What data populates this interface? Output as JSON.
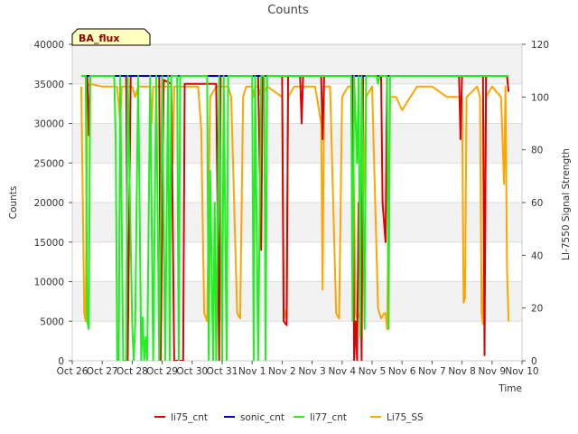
{
  "chart_data": {
    "type": "line",
    "title": "Counts",
    "badge": "BA_flux",
    "xlabel": "Time",
    "ylabel": "Counts",
    "y2label": "LI-7550 Signal Strength",
    "x_ticks": [
      "Oct 26",
      "Oct 27",
      "Oct 28",
      "Oct 29",
      "Oct 30",
      "Oct 31",
      "Nov 1",
      "Nov 2",
      "Nov 3",
      "Nov 4",
      "Nov 5",
      "Nov 6",
      "Nov 7",
      "Nov 8",
      "Nov 9",
      "Nov 10"
    ],
    "xlim": [
      0,
      15
    ],
    "ylim": [
      0,
      40000
    ],
    "y_ticks": [
      0,
      5000,
      10000,
      15000,
      20000,
      25000,
      30000,
      35000,
      40000
    ],
    "y2lim": [
      0,
      120
    ],
    "y2_ticks": [
      0,
      20,
      40,
      60,
      80,
      100,
      120
    ],
    "grid": true,
    "legend_position": "bottom",
    "series": [
      {
        "name": "li75_cnt",
        "color": "#dd0000",
        "axis": "left",
        "points": [
          [
            0.3,
            36000
          ],
          [
            0.5,
            36000
          ],
          [
            0.55,
            28500
          ],
          [
            0.6,
            36000
          ],
          [
            1.8,
            36000
          ],
          [
            1.85,
            0
          ],
          [
            1.95,
            36000
          ],
          [
            2.9,
            36000
          ],
          [
            2.95,
            0
          ],
          [
            3.05,
            35500
          ],
          [
            3.3,
            35000
          ],
          [
            3.4,
            0
          ],
          [
            3.7,
            0
          ],
          [
            3.75,
            35000
          ],
          [
            4.8,
            35000
          ],
          [
            4.9,
            0
          ],
          [
            4.95,
            36000
          ],
          [
            6.2,
            36000
          ],
          [
            6.3,
            14000
          ],
          [
            6.35,
            36000
          ],
          [
            7.0,
            36000
          ],
          [
            7.05,
            5000
          ],
          [
            7.15,
            4500
          ],
          [
            7.2,
            36000
          ],
          [
            7.6,
            36000
          ],
          [
            7.65,
            30000
          ],
          [
            7.7,
            36000
          ],
          [
            8.3,
            36000
          ],
          [
            8.35,
            28000
          ],
          [
            8.4,
            36000
          ],
          [
            9.35,
            36000
          ],
          [
            9.4,
            0
          ],
          [
            9.45,
            5000
          ],
          [
            9.5,
            0
          ],
          [
            9.55,
            20000
          ],
          [
            9.6,
            20000
          ],
          [
            9.65,
            0
          ],
          [
            9.7,
            36000
          ],
          [
            10.3,
            36000
          ],
          [
            10.35,
            20000
          ],
          [
            10.45,
            15000
          ],
          [
            10.5,
            36000
          ],
          [
            12.9,
            36000
          ],
          [
            12.95,
            28000
          ],
          [
            13.0,
            36000
          ],
          [
            13.7,
            36000
          ],
          [
            13.75,
            700
          ],
          [
            13.8,
            36000
          ],
          [
            14.5,
            36000
          ],
          [
            14.55,
            34000
          ]
        ]
      },
      {
        "name": "sonic_cnt",
        "color": "#0000cc",
        "axis": "left",
        "points": [
          [
            0.3,
            36000
          ],
          [
            14.55,
            36000
          ]
        ]
      },
      {
        "name": "li77_cnt",
        "color": "#22ee22",
        "axis": "left",
        "points": [
          [
            0.3,
            36000
          ],
          [
            0.45,
            36000
          ],
          [
            0.5,
            5000
          ],
          [
            0.55,
            4000
          ],
          [
            0.6,
            36000
          ],
          [
            1.4,
            36000
          ],
          [
            1.45,
            28000
          ],
          [
            1.5,
            0
          ],
          [
            1.55,
            0
          ],
          [
            1.6,
            36000
          ],
          [
            1.7,
            0
          ],
          [
            1.8,
            0
          ],
          [
            1.85,
            36000
          ],
          [
            2.0,
            4500
          ],
          [
            2.05,
            0
          ],
          [
            2.1,
            4500
          ],
          [
            2.2,
            36000
          ],
          [
            2.3,
            0
          ],
          [
            2.35,
            5500
          ],
          [
            2.4,
            0
          ],
          [
            2.45,
            3000
          ],
          [
            2.5,
            0
          ],
          [
            2.6,
            36000
          ],
          [
            2.7,
            0
          ],
          [
            2.8,
            36000
          ],
          [
            2.9,
            0
          ],
          [
            3.0,
            36000
          ],
          [
            3.1,
            0
          ],
          [
            3.2,
            36000
          ],
          [
            3.25,
            0
          ],
          [
            3.3,
            36000
          ],
          [
            3.5,
            36000
          ],
          [
            3.55,
            0
          ],
          [
            3.6,
            36000
          ],
          [
            4.5,
            36000
          ],
          [
            4.55,
            0
          ],
          [
            4.6,
            24000
          ],
          [
            4.7,
            0
          ],
          [
            4.75,
            20000
          ],
          [
            4.8,
            0
          ],
          [
            4.9,
            36000
          ],
          [
            5.0,
            0
          ],
          [
            5.05,
            36000
          ],
          [
            5.15,
            0
          ],
          [
            5.2,
            36000
          ],
          [
            6.0,
            36000
          ],
          [
            6.05,
            0
          ],
          [
            6.1,
            36000
          ],
          [
            6.2,
            0
          ],
          [
            6.3,
            36000
          ],
          [
            6.4,
            36000
          ],
          [
            6.45,
            0
          ],
          [
            6.5,
            36000
          ],
          [
            9.3,
            36000
          ],
          [
            9.35,
            5000
          ],
          [
            9.4,
            36000
          ],
          [
            9.5,
            25000
          ],
          [
            9.55,
            36000
          ],
          [
            9.6,
            3000
          ],
          [
            9.65,
            36000
          ],
          [
            9.75,
            4000
          ],
          [
            9.8,
            36000
          ],
          [
            10.15,
            36000
          ],
          [
            10.2,
            35000
          ],
          [
            10.25,
            36000
          ],
          [
            10.5,
            36000
          ],
          [
            10.55,
            4000
          ],
          [
            10.6,
            36000
          ],
          [
            14.55,
            36000
          ]
        ]
      },
      {
        "name": "Li75_SS",
        "color": "#ffa500",
        "axis": "right",
        "points": [
          [
            0.3,
            104
          ],
          [
            0.4,
            18
          ],
          [
            0.45,
            15
          ],
          [
            0.5,
            104
          ],
          [
            0.6,
            105
          ],
          [
            1.0,
            104
          ],
          [
            1.5,
            104
          ],
          [
            1.6,
            90
          ],
          [
            1.65,
            104
          ],
          [
            2.0,
            104
          ],
          [
            2.1,
            100
          ],
          [
            2.2,
            104
          ],
          [
            2.6,
            104
          ],
          [
            2.65,
            90
          ],
          [
            2.7,
            104
          ],
          [
            3.3,
            104
          ],
          [
            3.35,
            75
          ],
          [
            3.4,
            104
          ],
          [
            3.7,
            104
          ],
          [
            3.75,
            104
          ],
          [
            4.0,
            104
          ],
          [
            4.2,
            104
          ],
          [
            4.3,
            88
          ],
          [
            4.4,
            18
          ],
          [
            4.5,
            15
          ],
          [
            4.6,
            100
          ],
          [
            4.8,
            104
          ],
          [
            5.0,
            104
          ],
          [
            5.2,
            104
          ],
          [
            5.3,
            100
          ],
          [
            5.5,
            18
          ],
          [
            5.6,
            16
          ],
          [
            5.7,
            100
          ],
          [
            5.8,
            104
          ],
          [
            6.0,
            104
          ],
          [
            6.05,
            100
          ],
          [
            6.1,
            104
          ],
          [
            6.2,
            104
          ],
          [
            6.3,
            100
          ],
          [
            6.5,
            104
          ],
          [
            7.0,
            100
          ],
          [
            7.05,
            20
          ],
          [
            7.15,
            16
          ],
          [
            7.2,
            100
          ],
          [
            7.4,
            104
          ],
          [
            7.6,
            104
          ],
          [
            7.7,
            104
          ],
          [
            7.9,
            104
          ],
          [
            8.1,
            104
          ],
          [
            8.3,
            90
          ],
          [
            8.35,
            27
          ],
          [
            8.4,
            104
          ],
          [
            8.6,
            104
          ],
          [
            8.8,
            18
          ],
          [
            8.9,
            16
          ],
          [
            9.0,
            100
          ],
          [
            9.2,
            104
          ],
          [
            9.35,
            104
          ],
          [
            9.45,
            18
          ],
          [
            9.5,
            16
          ],
          [
            9.6,
            18
          ],
          [
            9.8,
            100
          ],
          [
            10.0,
            104
          ],
          [
            10.2,
            20
          ],
          [
            10.3,
            16
          ],
          [
            10.4,
            18
          ],
          [
            10.45,
            18
          ],
          [
            10.5,
            12
          ],
          [
            10.6,
            100
          ],
          [
            10.8,
            100
          ],
          [
            11.0,
            95
          ],
          [
            11.5,
            104
          ],
          [
            12.0,
            104
          ],
          [
            12.5,
            100
          ],
          [
            13.0,
            100
          ],
          [
            13.05,
            22
          ],
          [
            13.1,
            24
          ],
          [
            13.15,
            100
          ],
          [
            13.5,
            104
          ],
          [
            13.6,
            100
          ],
          [
            13.65,
            18
          ],
          [
            13.7,
            14
          ],
          [
            13.8,
            100
          ],
          [
            14.0,
            104
          ],
          [
            14.3,
            100
          ],
          [
            14.4,
            67
          ],
          [
            14.45,
            104
          ],
          [
            14.5,
            35
          ],
          [
            14.55,
            15
          ]
        ]
      }
    ]
  }
}
